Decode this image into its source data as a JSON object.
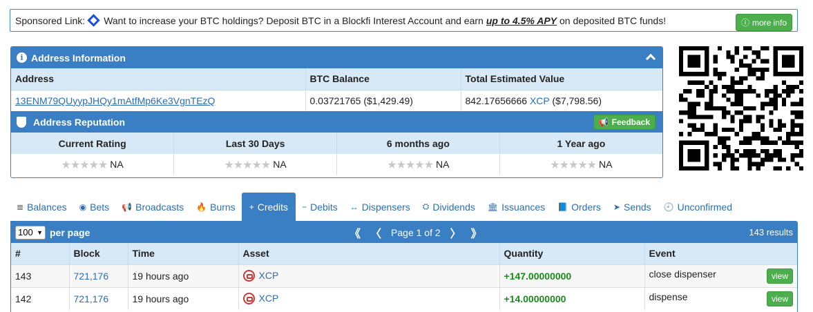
{
  "sponsor": {
    "prefix": "Sponsored Link:",
    "text": "Want to increase your BTC holdings? Deposit BTC in a Blockfi Interest Account and earn",
    "apy": "up to 4.5% APY",
    "suffix": "on deposited BTC funds!",
    "button": "more info"
  },
  "address_panel": {
    "title": "Address Information",
    "headers": {
      "address": "Address",
      "btc_balance": "BTC Balance",
      "total_value": "Total Estimated Value"
    },
    "address": "13ENM79QUyypJHQy1mAtfMp6Ke3VgnTEzQ",
    "btc_balance": "0.03721765 ($1,429.49)",
    "total_value_amount": "842.17656666",
    "total_value_asset": "XCP",
    "total_value_usd": "($7,798.56)"
  },
  "reputation": {
    "title": "Address Reputation",
    "feedback_button": "Feedback",
    "columns": [
      {
        "label": "Current Rating",
        "value": "NA"
      },
      {
        "label": "Last 30 Days",
        "value": "NA"
      },
      {
        "label": "6 months ago",
        "value": "NA"
      },
      {
        "label": "1 Year ago",
        "value": "NA"
      }
    ],
    "stars": "★★★★★"
  },
  "tabs": [
    {
      "label": "Balances",
      "icon": "≣"
    },
    {
      "label": "Bets",
      "icon": "◉"
    },
    {
      "label": "Broadcasts",
      "icon": "📢"
    },
    {
      "label": "Burns",
      "icon": "🔥"
    },
    {
      "label": "Credits",
      "icon": "+"
    },
    {
      "label": "Debits",
      "icon": "−"
    },
    {
      "label": "Dispensers",
      "icon": "↔"
    },
    {
      "label": "Dividends",
      "icon": "⛭"
    },
    {
      "label": "Issuances",
      "icon": "🏛"
    },
    {
      "label": "Orders",
      "icon": "📘"
    },
    {
      "label": "Sends",
      "icon": "➤"
    },
    {
      "label": "Unconfirmed",
      "icon": "🕘"
    }
  ],
  "active_tab": "Credits",
  "grid": {
    "per_page_value": "100",
    "per_page_label": "per page",
    "first": "《",
    "prev": "〈",
    "page_label": "Page 1 of 2",
    "next": "〉",
    "last": "》",
    "results": "143 results",
    "headers": [
      "#",
      "Block",
      "Time",
      "Asset",
      "Quantity",
      "Event"
    ],
    "rows": [
      {
        "num": "143",
        "block": "721,176",
        "time": "19 hours ago",
        "asset": "XCP",
        "quantity": "+147.00000000",
        "event": "close dispenser",
        "action": "view"
      },
      {
        "num": "142",
        "block": "721,176",
        "time": "19 hours ago",
        "asset": "XCP",
        "quantity": "+14.00000000",
        "event": "dispense",
        "action": "view"
      }
    ]
  },
  "colors": {
    "primary": "#3a7fc4",
    "header_bg": "#d7e9f7",
    "success": "#4cae4c",
    "positive": "#1a8a1a"
  }
}
